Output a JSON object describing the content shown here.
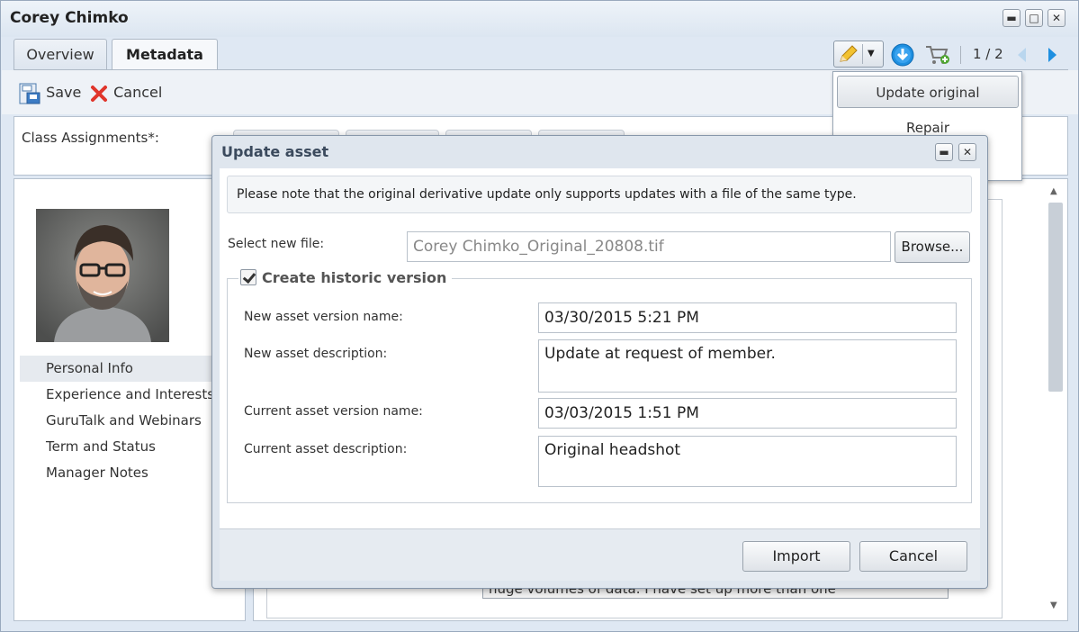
{
  "window": {
    "title": "Corey Chimko"
  },
  "tabs": [
    {
      "label": "Overview",
      "active": false
    },
    {
      "label": "Metadata",
      "active": true
    }
  ],
  "toolbar": {
    "save_label": "Save",
    "cancel_label": "Cancel"
  },
  "header_tools": {
    "pager": "1 / 2",
    "edit_icon": "pencil-icon",
    "download_icon": "download-icon",
    "cart_icon": "cart-add-icon"
  },
  "dropdown_menu": {
    "items": [
      "Update original",
      "Repair"
    ]
  },
  "class_assignments": {
    "label": "Class Assignments*:"
  },
  "nav": {
    "items": [
      {
        "label": "Personal Info",
        "selected": true
      },
      {
        "label": "Experience and Interests",
        "selected": false
      },
      {
        "label": "GuruTalk and Webinars",
        "selected": false
      },
      {
        "label": "Term and Status",
        "selected": false
      },
      {
        "label": "Manager Notes",
        "selected": false
      }
    ]
  },
  "background_text": "huge volumes of data. I have set up more than one",
  "dialog": {
    "title": "Update asset",
    "notice": "Please note that the original derivative update only supports updates with a file of the same type.",
    "select_file_label": "Select new file:",
    "file_value": "Corey Chimko_Original_20808.tif",
    "browse_label": "Browse...",
    "historic_label": "Create historic version",
    "historic_checked": true,
    "new_version_name_label": "New asset version name:",
    "new_version_name_value": "03/30/2015 5:21 PM",
    "new_description_label": "New asset description:",
    "new_description_value": "Update at request of member.",
    "current_version_name_label": "Current asset version name:",
    "current_version_name_value": "03/03/2015 1:51 PM",
    "current_description_label": "Current asset description:",
    "current_description_value": "Original headshot",
    "import_label": "Import",
    "cancel_label": "Cancel"
  },
  "colors": {
    "accent_blue": "#1e8fe0",
    "title_text": "#3b4a5d",
    "window_bg": "#dfe8f3"
  }
}
